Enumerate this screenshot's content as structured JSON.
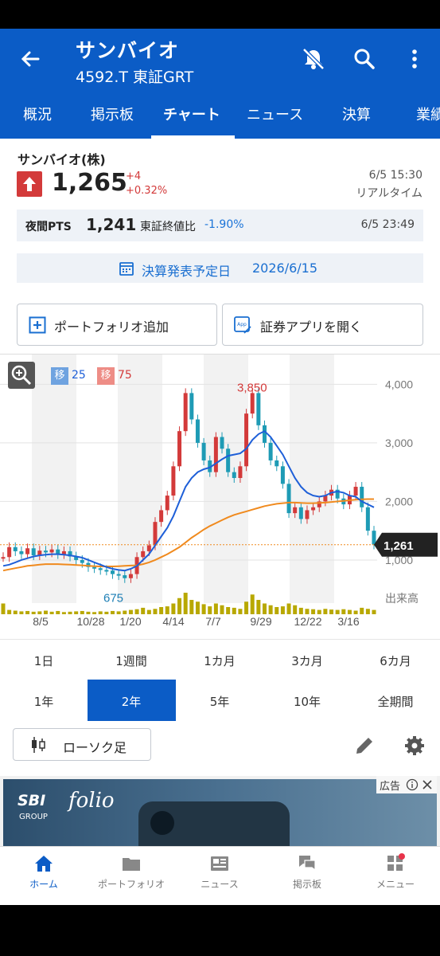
{
  "header": {
    "title": "サンバイオ",
    "subtitle": "4592.T 東証GRT"
  },
  "tabs": [
    "概況",
    "掲示板",
    "チャート",
    "ニュース",
    "決算",
    "業績"
  ],
  "quote": {
    "name": "サンバイオ(株)",
    "price": "1,265",
    "change": "+4",
    "change_pct": "+0.32%",
    "time": "6/5 15:30",
    "realtime": "リアルタイム"
  },
  "pts": {
    "label": "夜間PTS",
    "price": "1,241",
    "compare_label": "東証終値比",
    "compare_value": "-1.90%",
    "time": "6/5 23:49"
  },
  "earnings": {
    "label": "決算発表予定日",
    "date": "2026/6/15"
  },
  "actions": {
    "portfolio": "ポートフォリオ追加",
    "app": "証券アプリを開く"
  },
  "legend": {
    "ma_short_label": "移",
    "ma_short_value": "25",
    "ma_long_label": "移",
    "ma_long_value": "75"
  },
  "chart_data": {
    "type": "line",
    "x_ticks": [
      "8/5",
      "10/28",
      "1/20",
      "4/14",
      "7/7",
      "9/29",
      "12/22",
      "3/16"
    ],
    "y_ticks": [
      "4,000",
      "3,000",
      "2,000",
      "1,000"
    ],
    "y_range": [
      700,
      4100
    ],
    "volume_label": "出来高",
    "high_label": "3,850",
    "low_label": "675",
    "last_price_label": "1,261",
    "price_series": [
      1050,
      1220,
      1150,
      1100,
      1200,
      1080,
      1160,
      1130,
      1180,
      1100,
      1150,
      1060,
      1000,
      950,
      880,
      860,
      830,
      820,
      760,
      740,
      690,
      760,
      1050,
      1150,
      1250,
      1650,
      1850,
      2100,
      2600,
      3200,
      3850,
      3400,
      3000,
      2700,
      2500,
      3100,
      2900,
      2500,
      2400,
      2600,
      3500,
      3850,
      3300,
      3000,
      2700,
      2600,
      2300,
      1800,
      1900,
      1700,
      1850,
      1900,
      2000,
      2100,
      2200,
      2050,
      1950,
      2100,
      2250,
      1900,
      1500,
      1265
    ],
    "ma25": [
      900,
      920,
      960,
      1000,
      1030,
      1060,
      1080,
      1090,
      1100,
      1100,
      1090,
      1080,
      1060,
      1040,
      1000,
      960,
      920,
      880,
      850,
      830,
      820,
      850,
      900,
      1000,
      1100,
      1250,
      1400,
      1550,
      1750,
      2000,
      2250,
      2400,
      2500,
      2550,
      2580,
      2650,
      2720,
      2780,
      2800,
      2820,
      2900,
      3050,
      3150,
      3200,
      3100,
      2950,
      2800,
      2600,
      2400,
      2250,
      2150,
      2100,
      2080,
      2100,
      2150,
      2170,
      2150,
      2100,
      2080,
      2000,
      1950,
      1900
    ],
    "ma75": [
      820,
      840,
      860,
      880,
      900,
      910,
      920,
      930,
      930,
      930,
      925,
      920,
      915,
      910,
      900,
      895,
      890,
      890,
      890,
      895,
      900,
      905,
      910,
      930,
      960,
      1000,
      1050,
      1100,
      1160,
      1220,
      1300,
      1380,
      1450,
      1520,
      1580,
      1630,
      1680,
      1730,
      1770,
      1800,
      1830,
      1860,
      1890,
      1920,
      1940,
      1960,
      1970,
      1980,
      1980,
      1975,
      1970,
      1970,
      1975,
      1980,
      1990,
      2000,
      2010,
      2020,
      2030,
      2035,
      2040,
      2040
    ],
    "volume": [
      30,
      12,
      10,
      8,
      9,
      7,
      8,
      10,
      7,
      9,
      6,
      7,
      8,
      9,
      7,
      6,
      8,
      7,
      9,
      8,
      10,
      12,
      14,
      18,
      12,
      15,
      20,
      22,
      30,
      45,
      60,
      40,
      35,
      28,
      22,
      30,
      25,
      20,
      18,
      15,
      35,
      55,
      40,
      30,
      25,
      20,
      22,
      30,
      25,
      18,
      15,
      14,
      12,
      15,
      13,
      12,
      14,
      12,
      10,
      18,
      15,
      12
    ]
  },
  "periods_row1": [
    "1日",
    "1週間",
    "1カ月",
    "3カ月",
    "6カ月"
  ],
  "periods_row2": [
    "1年",
    "2年",
    "5年",
    "10年",
    "全期間"
  ],
  "chart_type": "ローソク足",
  "ad": {
    "label": "広告",
    "brand": "SBI",
    "brand_sub": "GROUP",
    "product": "folio"
  },
  "bottom_nav": [
    "ホーム",
    "ポートフォリオ",
    "ニュース",
    "掲示板",
    "メニュー"
  ],
  "colors": {
    "brand": "#0b5cc6",
    "up": "#d33a3a",
    "down": "#1e9bb5",
    "ma25": "#1e5fd8",
    "ma75": "#f08a1e"
  }
}
